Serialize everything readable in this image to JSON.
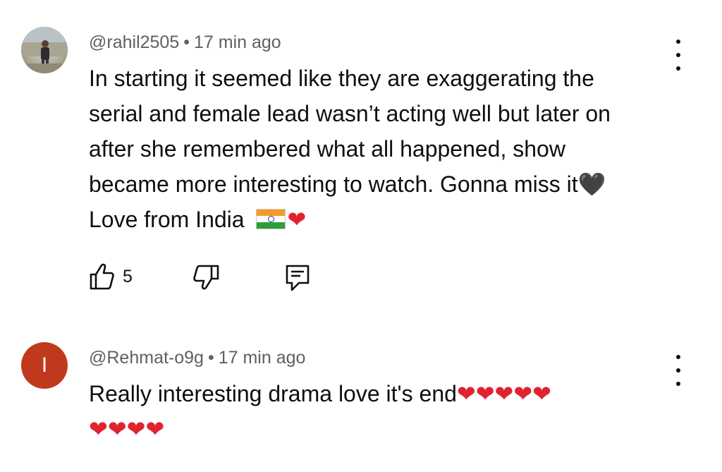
{
  "comments": [
    {
      "handle": "@rahil2505",
      "separator": "•",
      "time": "17 min ago",
      "lines": [
        "In starting it seemed like they are exaggerating the",
        "serial and female lead wasn’t acting well but later on",
        "after she remembered what all happened, show",
        "became more interesting to watch. Gonna miss it",
        "Love from India "
      ],
      "line4_emoji": "🖤",
      "line5_emoji_heart": "❤",
      "like_count": "5",
      "avatar_icon": "user-photo-avatar"
    },
    {
      "handle": "@Rehmat-o9g",
      "separator": "•",
      "time": "17 min ago",
      "lines": [
        "Really interesting drama love it's end"
      ],
      "line1_emoji": "❤❤❤❤❤",
      "line2_emoji": "❤❤❤❤",
      "avatar_letter": "I",
      "avatar_color": "#c1391c"
    }
  ],
  "icons": {
    "like": "thumbs-up-icon",
    "dislike": "thumbs-down-icon",
    "reply": "reply-icon",
    "more": "more-vert-icon"
  }
}
